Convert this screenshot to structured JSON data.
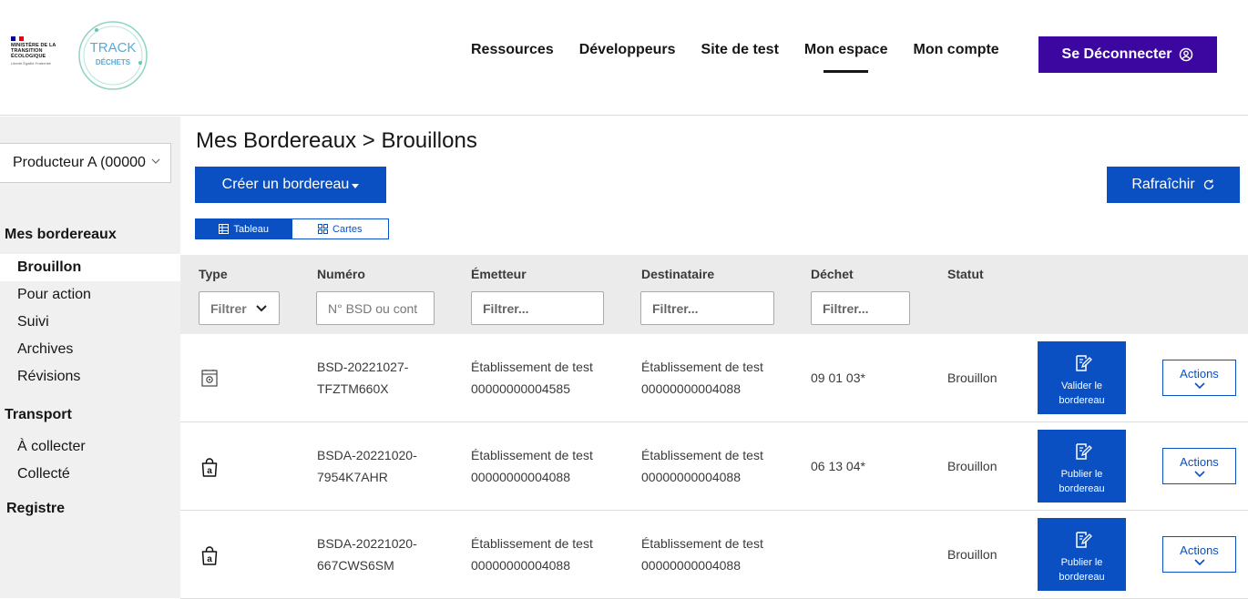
{
  "header": {
    "gov_logo_text": "MINISTÈRE DE LA TRANSITION ÉCOLOGIQUE",
    "gov_logo_motto": "Liberté Égalité Fraternité",
    "logo_line1": "TRACK",
    "logo_line2": "DÉCHETS",
    "nav": [
      "Ressources",
      "Développeurs",
      "Site de test",
      "Mon espace",
      "Mon compte"
    ],
    "logout_label": "Se Déconnecter"
  },
  "sidebar": {
    "company": "Producteur A (00000",
    "section_bordereaux": "Mes bordereaux",
    "items_bordereaux": [
      "Brouillon",
      "Pour action",
      "Suivi",
      "Archives",
      "Révisions"
    ],
    "section_transport": "Transport",
    "items_transport": [
      "À collecter",
      "Collecté"
    ],
    "section_registre": "Registre"
  },
  "main": {
    "title": "Mes Bordereaux > Brouillons",
    "create_label": "Créer un bordereau",
    "refresh_label": "Rafraîchir",
    "view_table": "Tableau",
    "view_cards": "Cartes"
  },
  "table": {
    "headers": [
      "Type",
      "Numéro",
      "Émetteur",
      "Destinataire",
      "Déchet",
      "Statut"
    ],
    "filters": {
      "type": "Filtrer",
      "numero": "N° BSD ou cont",
      "emetteur": "Filtrer...",
      "destinataire": "Filtrer...",
      "dechet": "Filtrer..."
    },
    "rows": [
      {
        "type_icon": "bsd-form-icon",
        "numero_1": "BSD-20221027-",
        "numero_2": "TFZTM660X",
        "emetteur_1": "Établissement de test",
        "emetteur_2": "00000000004585",
        "destinataire_1": "Établissement de test",
        "destinataire_2": "00000000004088",
        "dechet": "09 01 03*",
        "statut": "Brouillon",
        "primary_action_1": "Valider le",
        "primary_action_2": "bordereau",
        "actions_label": "Actions"
      },
      {
        "type_icon": "asbestos-bag-icon",
        "numero_1": "BSDA-20221020-",
        "numero_2": "7954K7AHR",
        "emetteur_1": "Établissement de test",
        "emetteur_2": "00000000004088",
        "destinataire_1": "Établissement de test",
        "destinataire_2": "00000000004088",
        "dechet": "06 13 04*",
        "statut": "Brouillon",
        "primary_action_1": "Publier le",
        "primary_action_2": "bordereau",
        "actions_label": "Actions"
      },
      {
        "type_icon": "asbestos-bag-icon",
        "numero_1": "BSDA-20221020-",
        "numero_2": "667CWS6SM",
        "emetteur_1": "Établissement de test",
        "emetteur_2": "00000000004088",
        "destinataire_1": "Établissement de test",
        "destinataire_2": "00000000004088",
        "dechet": "",
        "statut": "Brouillon",
        "primary_action_1": "Publier le",
        "primary_action_2": "bordereau",
        "actions_label": "Actions"
      }
    ]
  },
  "colors": {
    "primary": "#0b50c2",
    "logout": "#3c07a0",
    "sidebar_bg": "#f0f0f0",
    "table_header_bg": "#ebebeb"
  }
}
